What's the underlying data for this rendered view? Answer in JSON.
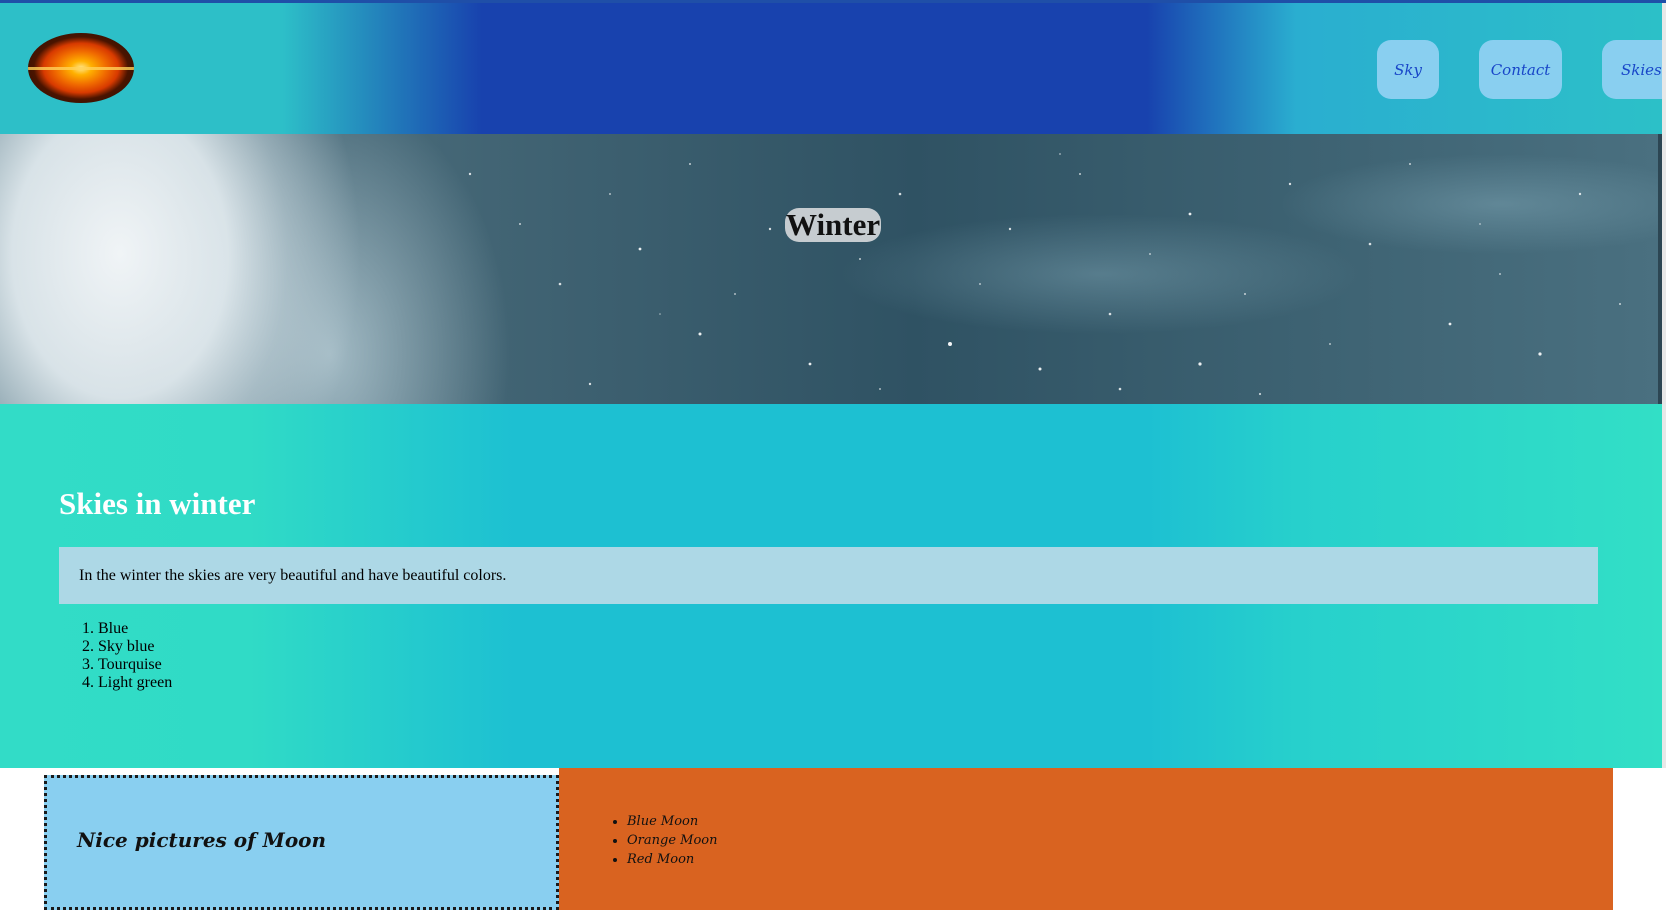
{
  "header": {
    "logo": "sunset-logo",
    "nav": [
      {
        "label": "Sky"
      },
      {
        "label": "Contact"
      },
      {
        "label": "Skies"
      }
    ]
  },
  "hero": {
    "title": "Winter"
  },
  "main": {
    "heading": "Skies in winter",
    "paragraph": "In the winter the skies are very beautiful and have beautiful colors.",
    "colors": [
      "Blue",
      "Sky blue",
      "Tourquise",
      "Light green"
    ]
  },
  "footer": {
    "left_heading": "Nice pictures of Moon",
    "moons": [
      "Blue Moon",
      "Orange Moon",
      "Red Moon"
    ]
  },
  "theme": {
    "header_blue": "#1842ae",
    "teal": "#1dc0d2",
    "nav_button": "#89cff0",
    "info_box": "#add8e6",
    "orange": "#d96320"
  }
}
